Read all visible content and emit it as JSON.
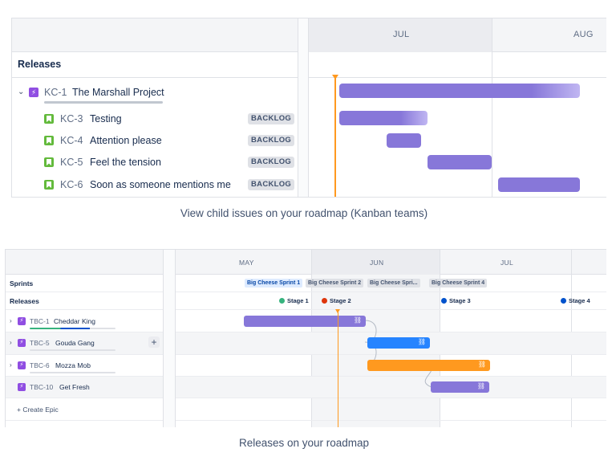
{
  "panel1": {
    "months": [
      "JUL",
      "AUG"
    ],
    "releases_label": "Releases",
    "parent": {
      "key": "KC-1",
      "title": "The Marshall Project",
      "icon": "epic-icon",
      "expand_icon": "chevron-down-icon"
    },
    "children": [
      {
        "key": "KC-3",
        "title": "Testing",
        "status": "BACKLOG",
        "icon": "story-icon"
      },
      {
        "key": "KC-4",
        "title": "Attention please",
        "status": "BACKLOG",
        "icon": "story-icon"
      },
      {
        "key": "KC-5",
        "title": "Feel the tension",
        "status": "BACKLOG",
        "icon": "story-icon"
      },
      {
        "key": "KC-6",
        "title": "Soon as someone mentions me",
        "status": "BACKLOG",
        "icon": "story-icon"
      }
    ],
    "caption": "View child issues on your roadmap (Kanban teams)",
    "colors": {
      "bar": "#8777d9",
      "today": "#ff991f",
      "epic": "#904ee2",
      "story": "#63ba3c"
    }
  },
  "panel2": {
    "months": [
      "MAY",
      "JUN",
      "JUL"
    ],
    "sprints_label": "Sprints",
    "releases_label": "Releases",
    "sprints": [
      "Big Cheese Sprint 1",
      "Big Cheese Sprint 2",
      "Big Cheese Spri...",
      "Big Cheese Sprint 4"
    ],
    "stages": [
      {
        "label": "Stage 1",
        "color": "#36b37e"
      },
      {
        "label": "Stage 2",
        "color": "#de350b"
      },
      {
        "label": "Stage 3",
        "color": "#0052cc"
      },
      {
        "label": "Stage 4",
        "color": "#0052cc"
      }
    ],
    "epics": [
      {
        "key": "TBC-1",
        "title": "Cheddar King",
        "bar_color": "#8777d9",
        "expand_icon": "chevron-right-icon"
      },
      {
        "key": "TBC-5",
        "title": "Gouda Gang",
        "bar_color": "#2684ff",
        "expand_icon": "chevron-right-icon"
      },
      {
        "key": "TBC-6",
        "title": "Mozza Mob",
        "bar_color": "#ff991f",
        "expand_icon": "chevron-right-icon"
      },
      {
        "key": "TBC-10",
        "title": "Get Fresh",
        "bar_color": "#8777d9"
      }
    ],
    "add_label": "+",
    "create_label": "+ Create Epic",
    "link_icon": "link-icon",
    "caption": "Releases on your roadmap"
  }
}
